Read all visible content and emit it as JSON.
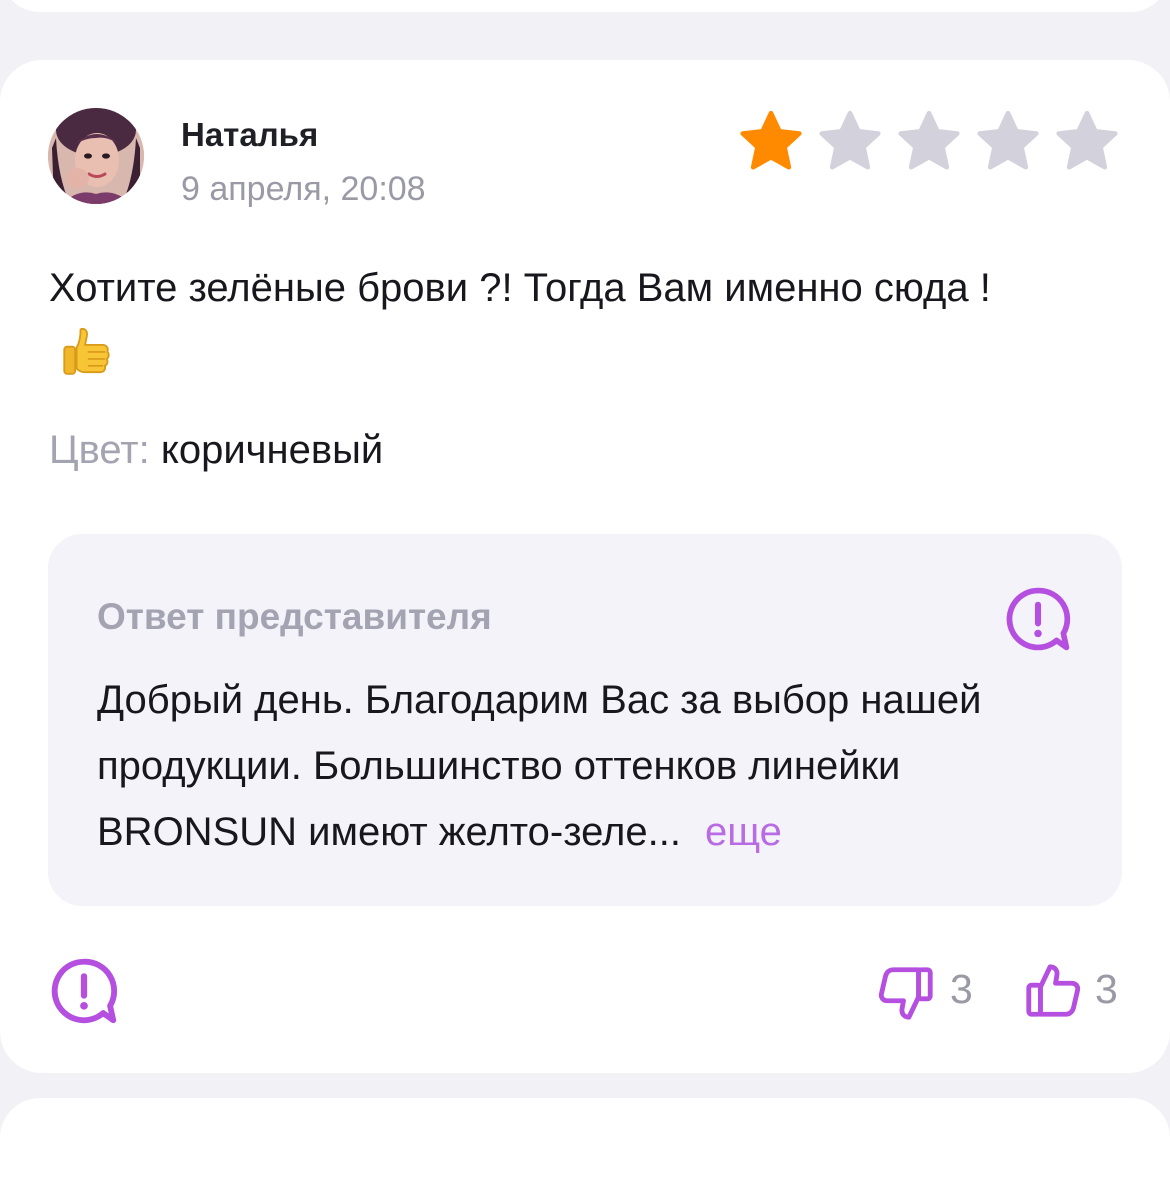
{
  "review": {
    "author": "Наталья",
    "date": "9 апреля, 20:08",
    "rating": 1,
    "rating_max": 5,
    "text": "Хотите зелёные брови ?! Тогда Вам именно сюда !",
    "emoji": "thumbs-up-emoji",
    "color_label": "Цвет:",
    "color_value": "коричневый"
  },
  "answer": {
    "title": "Ответ представителя",
    "text": "Добрый день. Благодарим Вас за выбор нашей продукции. Большинство оттенков линейки BRONSUN имеют желто-зеле...",
    "more_label": "еще"
  },
  "actions": {
    "dislike_count": "3",
    "like_count": "3"
  },
  "colors": {
    "star_active": "#ff8a00",
    "star_inactive": "#d3d2dc",
    "accent": "#b44fe0",
    "muted_text": "#9a9aa6"
  },
  "icons": {
    "report": "report-icon",
    "dislike": "thumbs-down-icon",
    "like": "thumbs-up-icon"
  }
}
